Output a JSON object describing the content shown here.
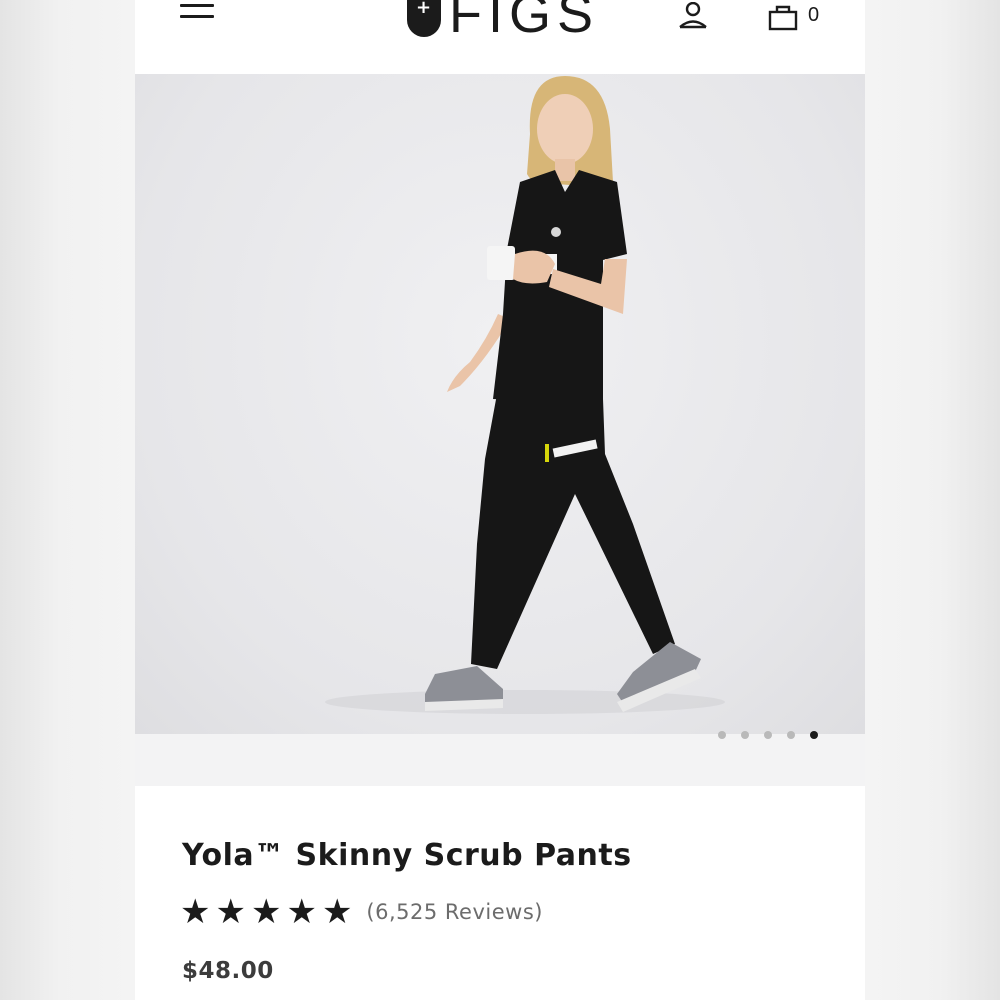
{
  "header": {
    "menu_icon": "hamburger-icon",
    "logo_text": "FIGS",
    "account_icon": "user-icon",
    "cart_icon": "shopping-bag-icon",
    "cart_count": "0"
  },
  "gallery": {
    "slides": 5,
    "active_slide": 5
  },
  "product": {
    "title": "Yola™ Skinny Scrub Pants",
    "rating": 5,
    "star_icon": "star-icon",
    "reviews": "(6,525 Reviews)",
    "price": "$48.00"
  }
}
